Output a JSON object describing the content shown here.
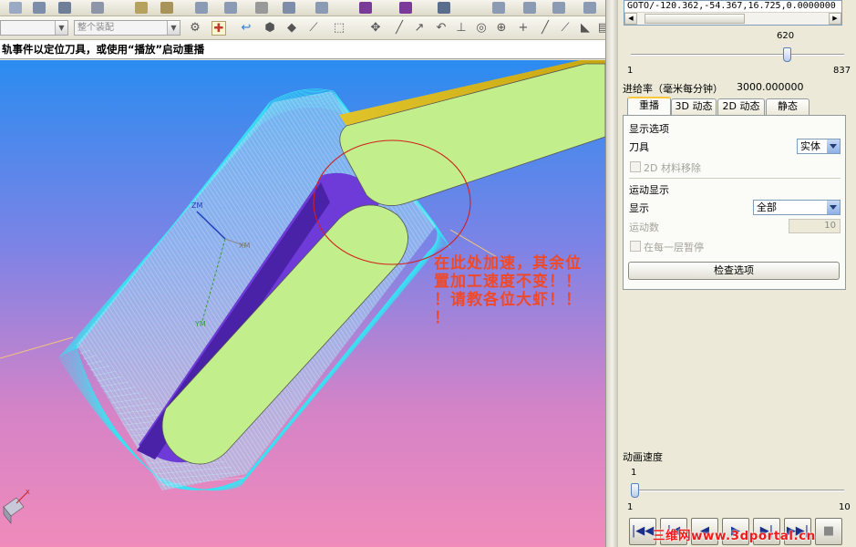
{
  "toolbar": {
    "combo_left_value": "",
    "combo_assembly_value": "整个装配"
  },
  "status_cue": "轨事件以定位刀具，或使用“播放”启动重播",
  "viewport": {
    "annotation_lines": [
      "在此处加速，其余位",
      "置加工速度不变！！",
      "！请教各位大虾！！",
      "！"
    ],
    "triad_labels": {
      "zm": "ZM",
      "xm": "XM",
      "ym": "YM",
      "x": "X"
    }
  },
  "panel": {
    "goto_text": "GOTO/-120.362,-54.367,16.725,0.0000000",
    "position_slider": {
      "current": "620",
      "min": "1",
      "max": "837",
      "fraction": 0.74
    },
    "feedrate_label": "进给率（毫米每分钟）",
    "feedrate_value": "3000.000000",
    "tabs": [
      {
        "label": "重播",
        "active": true
      },
      {
        "label": "3D 动态",
        "active": false
      },
      {
        "label": "2D 动态",
        "active": false
      },
      {
        "label": "静态",
        "active": false
      }
    ],
    "display_options_title": "显示选项",
    "tool_label": "刀具",
    "tool_value": "实体",
    "material_removal_label": "2D 材料移除",
    "motion_display_title": "运动显示",
    "display_label": "显示",
    "display_value": "全部",
    "motion_count_label": "运动数",
    "motion_count_value": "10",
    "pause_each_layer_label": "在每一层暂停",
    "check_options_label": "检查选项",
    "anim_speed_label": "动画速度",
    "anim_slider": {
      "current": "1",
      "min": "1",
      "max": "10",
      "fraction": 0.0
    },
    "playback_buttons": [
      "|◀◀",
      "|◀",
      "◀",
      "▶",
      "▶|",
      "▶▶|",
      "■"
    ]
  },
  "watermark": "三维网www.3dportal.cn",
  "colors": {
    "part_fill": "#c3ee8c",
    "toolpath": "#35e6f5",
    "groove": "#6e3bd8",
    "annotation": "#ee4a2a"
  }
}
